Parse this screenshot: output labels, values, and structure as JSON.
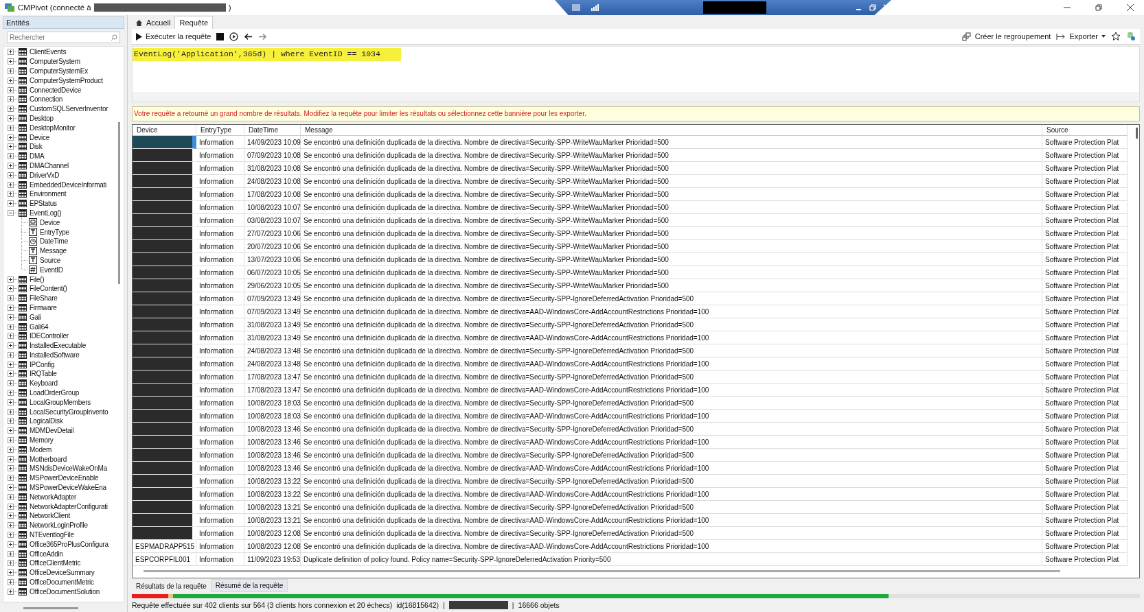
{
  "window": {
    "title_prefix": "CMPivot (connecté à",
    "title_suffix": ")"
  },
  "entities": {
    "header": "Entités",
    "search": {
      "placeholder": "Rechercher"
    },
    "items": [
      {
        "label": "ClientEvents",
        "expanded": false
      },
      {
        "label": "ComputerSystem",
        "expanded": false
      },
      {
        "label": "ComputerSystemEx",
        "expanded": false
      },
      {
        "label": "ComputerSystemProduct",
        "expanded": false
      },
      {
        "label": "ConnectedDevice",
        "expanded": false
      },
      {
        "label": "Connection",
        "expanded": false
      },
      {
        "label": "CustomSQLServerInventor",
        "expanded": false
      },
      {
        "label": "Desktop",
        "expanded": false
      },
      {
        "label": "DesktopMonitor",
        "expanded": false
      },
      {
        "label": "Device",
        "expanded": false
      },
      {
        "label": "Disk",
        "expanded": false
      },
      {
        "label": "DMA",
        "expanded": false
      },
      {
        "label": "DMAChannel",
        "expanded": false
      },
      {
        "label": "DriverVxD",
        "expanded": false
      },
      {
        "label": "EmbeddedDeviceInformati",
        "expanded": false
      },
      {
        "label": "Environment",
        "expanded": false
      },
      {
        "label": "EPStatus",
        "expanded": false
      },
      {
        "label": "EventLog()",
        "expanded": true,
        "children": [
          {
            "label": "Device",
            "kind": "device"
          },
          {
            "label": "EntryType",
            "kind": "text"
          },
          {
            "label": "DateTime",
            "kind": "clock"
          },
          {
            "label": "Message",
            "kind": "text"
          },
          {
            "label": "Source",
            "kind": "text"
          },
          {
            "label": "EventID",
            "kind": "number"
          }
        ]
      },
      {
        "label": "File()",
        "expanded": false
      },
      {
        "label": "FileContent()",
        "expanded": false
      },
      {
        "label": "FileShare",
        "expanded": false
      },
      {
        "label": "Firmware",
        "expanded": false
      },
      {
        "label": "Gali",
        "expanded": false
      },
      {
        "label": "Gali64",
        "expanded": false
      },
      {
        "label": "IDEController",
        "expanded": false
      },
      {
        "label": "InstalledExecutable",
        "expanded": false
      },
      {
        "label": "InstalledSoftware",
        "expanded": false
      },
      {
        "label": "IPConfig",
        "expanded": false
      },
      {
        "label": "IRQTable",
        "expanded": false
      },
      {
        "label": "Keyboard",
        "expanded": false
      },
      {
        "label": "LoadOrderGroup",
        "expanded": false
      },
      {
        "label": "LocalGroupMembers",
        "expanded": false
      },
      {
        "label": "LocalSecurityGroupInvento",
        "expanded": false
      },
      {
        "label": "LogicalDisk",
        "expanded": false
      },
      {
        "label": "MDMDevDetail",
        "expanded": false
      },
      {
        "label": "Memory",
        "expanded": false
      },
      {
        "label": "Modem",
        "expanded": false
      },
      {
        "label": "Motherboard",
        "expanded": false
      },
      {
        "label": "MSNdisDeviceWakeOnMa",
        "expanded": false
      },
      {
        "label": "MSPowerDeviceEnable",
        "expanded": false
      },
      {
        "label": "MSPowerDeviceWakeEna",
        "expanded": false
      },
      {
        "label": "NetworkAdapter",
        "expanded": false
      },
      {
        "label": "NetworkAdapterConfigurati",
        "expanded": false
      },
      {
        "label": "NetworkClient",
        "expanded": false
      },
      {
        "label": "NetworkLoginProfile",
        "expanded": false
      },
      {
        "label": "NTEventlogFile",
        "expanded": false
      },
      {
        "label": "Office365ProPlusConfigura",
        "expanded": false
      },
      {
        "label": "OfficeAddin",
        "expanded": false
      },
      {
        "label": "OfficeClientMetric",
        "expanded": false
      },
      {
        "label": "OfficeDeviceSummary",
        "expanded": false
      },
      {
        "label": "OfficeDocumentMetric",
        "expanded": false
      },
      {
        "label": "OfficeDocumentSolution",
        "expanded": false
      }
    ]
  },
  "tabs": [
    {
      "label": "Accueil",
      "selected": false,
      "kind": "home"
    },
    {
      "label": "Requête",
      "selected": true
    }
  ],
  "toolbar": {
    "run": "Exécuter la requête",
    "group": "Créer le regroupement",
    "export": "Exporter"
  },
  "query": "EventLog('Application',365d) | where EventID == 1034",
  "banner": "Votre requête a retourné un grand nombre de résultats. Modifiez la requête pour limiter les résultats ou sélectionnez cette bannière pour les exporter.",
  "table": {
    "columns": [
      "Device",
      "EntryType",
      "DateTime",
      "Message",
      "Source"
    ],
    "rows": [
      {
        "redacted": true,
        "selected": true,
        "type": "Information",
        "time": "14/09/2023 10:09",
        "message": "Se encontró una definición duplicada de la directiva. Nombre de directiva=Security-SPP-WriteWauMarker  Prioridad=500",
        "source": "Software Protection Plat"
      },
      {
        "redacted": true,
        "selected": false,
        "type": "Information",
        "time": "07/09/2023 10:08",
        "message": "Se encontró una definición duplicada de la directiva. Nombre de directiva=Security-SPP-WriteWauMarker  Prioridad=500",
        "source": "Software Protection Plat"
      },
      {
        "redacted": true,
        "selected": false,
        "type": "Information",
        "time": "31/08/2023 10:08",
        "message": "Se encontró una definición duplicada de la directiva. Nombre de directiva=Security-SPP-WriteWauMarker  Prioridad=500",
        "source": "Software Protection Plat"
      },
      {
        "redacted": true,
        "selected": false,
        "type": "Information",
        "time": "24/08/2023 10:08",
        "message": "Se encontró una definición duplicada de la directiva. Nombre de directiva=Security-SPP-WriteWauMarker  Prioridad=500",
        "source": "Software Protection Plat"
      },
      {
        "redacted": true,
        "selected": false,
        "type": "Information",
        "time": "17/08/2023 10:08",
        "message": "Se encontró una definición duplicada de la directiva. Nombre de directiva=Security-SPP-WriteWauMarker  Prioridad=500",
        "source": "Software Protection Plat"
      },
      {
        "redacted": true,
        "selected": false,
        "type": "Information",
        "time": "10/08/2023 10:07",
        "message": "Se encontró una definición duplicada de la directiva. Nombre de directiva=Security-SPP-WriteWauMarker  Prioridad=500",
        "source": "Software Protection Plat"
      },
      {
        "redacted": true,
        "selected": false,
        "type": "Information",
        "time": "03/08/2023 10:07",
        "message": "Se encontró una definición duplicada de la directiva. Nombre de directiva=Security-SPP-WriteWauMarker  Prioridad=500",
        "source": "Software Protection Plat"
      },
      {
        "redacted": true,
        "selected": false,
        "type": "Information",
        "time": "27/07/2023 10:06",
        "message": "Se encontró una definición duplicada de la directiva. Nombre de directiva=Security-SPP-WriteWauMarker  Prioridad=500",
        "source": "Software Protection Plat"
      },
      {
        "redacted": true,
        "selected": false,
        "type": "Information",
        "time": "20/07/2023 10:06",
        "message": "Se encontró una definición duplicada de la directiva. Nombre de directiva=Security-SPP-WriteWauMarker  Prioridad=500",
        "source": "Software Protection Plat"
      },
      {
        "redacted": true,
        "selected": false,
        "type": "Information",
        "time": "13/07/2023 10:06",
        "message": "Se encontró una definición duplicada de la directiva. Nombre de directiva=Security-SPP-WriteWauMarker  Prioridad=500",
        "source": "Software Protection Plat"
      },
      {
        "redacted": true,
        "selected": false,
        "type": "Information",
        "time": "06/07/2023 10:05",
        "message": "Se encontró una definición duplicada de la directiva. Nombre de directiva=Security-SPP-WriteWauMarker  Prioridad=500",
        "source": "Software Protection Plat"
      },
      {
        "redacted": true,
        "selected": false,
        "type": "Information",
        "time": "29/06/2023 10:05",
        "message": "Se encontró una definición duplicada de la directiva. Nombre de directiva=Security-SPP-WriteWauMarker  Prioridad=500",
        "source": "Software Protection Plat"
      },
      {
        "redacted": true,
        "selected": false,
        "type": "Information",
        "time": "07/09/2023 13:49",
        "message": "Se encontró una definición duplicada de la directiva. Nombre de directiva=Security-SPP-IgnoreDeferredActivation  Prioridad=500",
        "source": "Software Protection Plat"
      },
      {
        "redacted": true,
        "selected": false,
        "type": "Information",
        "time": "07/09/2023 13:49",
        "message": "Se encontró una definición duplicada de la directiva. Nombre de directiva=AAD-WindowsCore-AddAccountRestrictions  Prioridad=100",
        "source": "Software Protection Plat"
      },
      {
        "redacted": true,
        "selected": false,
        "type": "Information",
        "time": "31/08/2023 13:49",
        "message": "Se encontró una definición duplicada de la directiva. Nombre de directiva=Security-SPP-IgnoreDeferredActivation  Prioridad=500",
        "source": "Software Protection Plat"
      },
      {
        "redacted": true,
        "selected": false,
        "type": "Information",
        "time": "31/08/2023 13:49",
        "message": "Se encontró una definición duplicada de la directiva. Nombre de directiva=AAD-WindowsCore-AddAccountRestrictions  Prioridad=100",
        "source": "Software Protection Plat"
      },
      {
        "redacted": true,
        "selected": false,
        "type": "Information",
        "time": "24/08/2023 13:48",
        "message": "Se encontró una definición duplicada de la directiva. Nombre de directiva=Security-SPP-IgnoreDeferredActivation  Prioridad=500",
        "source": "Software Protection Plat"
      },
      {
        "redacted": true,
        "selected": false,
        "type": "Information",
        "time": "24/08/2023 13:48",
        "message": "Se encontró una definición duplicada de la directiva. Nombre de directiva=AAD-WindowsCore-AddAccountRestrictions  Prioridad=100",
        "source": "Software Protection Plat"
      },
      {
        "redacted": true,
        "selected": false,
        "type": "Information",
        "time": "17/08/2023 13:47",
        "message": "Se encontró una definición duplicada de la directiva. Nombre de directiva=Security-SPP-IgnoreDeferredActivation  Prioridad=500",
        "source": "Software Protection Plat"
      },
      {
        "redacted": true,
        "selected": false,
        "type": "Information",
        "time": "17/08/2023 13:47",
        "message": "Se encontró una definición duplicada de la directiva. Nombre de directiva=AAD-WindowsCore-AddAccountRestrictions  Prioridad=100",
        "source": "Software Protection Plat"
      },
      {
        "redacted": true,
        "selected": false,
        "type": "Information",
        "time": "10/08/2023 18:03",
        "message": "Se encontró una definición duplicada de la directiva. Nombre de directiva=Security-SPP-IgnoreDeferredActivation  Prioridad=500",
        "source": "Software Protection Plat"
      },
      {
        "redacted": true,
        "selected": false,
        "type": "Information",
        "time": "10/08/2023 18:03",
        "message": "Se encontró una definición duplicada de la directiva. Nombre de directiva=AAD-WindowsCore-AddAccountRestrictions  Prioridad=100",
        "source": "Software Protection Plat"
      },
      {
        "redacted": true,
        "selected": false,
        "type": "Information",
        "time": "10/08/2023 13:46",
        "message": "Se encontró una definición duplicada de la directiva. Nombre de directiva=Security-SPP-IgnoreDeferredActivation  Prioridad=500",
        "source": "Software Protection Plat"
      },
      {
        "redacted": true,
        "selected": false,
        "type": "Information",
        "time": "10/08/2023 13:46",
        "message": "Se encontró una definición duplicada de la directiva. Nombre de directiva=AAD-WindowsCore-AddAccountRestrictions  Prioridad=100",
        "source": "Software Protection Plat"
      },
      {
        "redacted": true,
        "selected": false,
        "type": "Information",
        "time": "10/08/2023 13:46",
        "message": "Se encontró una definición duplicada de la directiva. Nombre de directiva=Security-SPP-IgnoreDeferredActivation  Prioridad=500",
        "source": "Software Protection Plat"
      },
      {
        "redacted": true,
        "selected": false,
        "type": "Information",
        "time": "10/08/2023 13:46",
        "message": "Se encontró una definición duplicada de la directiva. Nombre de directiva=AAD-WindowsCore-AddAccountRestrictions  Prioridad=100",
        "source": "Software Protection Plat"
      },
      {
        "redacted": true,
        "selected": false,
        "type": "Information",
        "time": "10/08/2023 13:22",
        "message": "Se encontró una definición duplicada de la directiva. Nombre de directiva=Security-SPP-IgnoreDeferredActivation  Prioridad=500",
        "source": "Software Protection Plat"
      },
      {
        "redacted": true,
        "selected": false,
        "type": "Information",
        "time": "10/08/2023 13:22",
        "message": "Se encontró una definición duplicada de la directiva. Nombre de directiva=AAD-WindowsCore-AddAccountRestrictions  Prioridad=100",
        "source": "Software Protection Plat"
      },
      {
        "redacted": true,
        "selected": false,
        "type": "Information",
        "time": "10/08/2023 13:21",
        "message": "Se encontró una definición duplicada de la directiva. Nombre de directiva=Security-SPP-IgnoreDeferredActivation  Prioridad=500",
        "source": "Software Protection Plat"
      },
      {
        "redacted": true,
        "selected": false,
        "type": "Information",
        "time": "10/08/2023 13:21",
        "message": "Se encontró una definición duplicada de la directiva. Nombre de directiva=AAD-WindowsCore-AddAccountRestrictions  Prioridad=100",
        "source": "Software Protection Plat"
      },
      {
        "redacted": true,
        "selected": false,
        "type": "Information",
        "time": "10/08/2023 12:08",
        "message": "Se encontró una definición duplicada de la directiva. Nombre de directiva=Security-SPP-IgnoreDeferredActivation  Prioridad=500",
        "source": "Software Protection Plat"
      },
      {
        "redacted": false,
        "selected": false,
        "device": "ESPMADRAPP515",
        "type": "Information",
        "time": "10/08/2023 12:08",
        "message": "Se encontró una definición duplicada de la directiva. Nombre de directiva=AAD-WindowsCore-AddAccountRestrictions  Prioridad=100",
        "source": "Software Protection Plat"
      },
      {
        "redacted": false,
        "selected": false,
        "device": "ESPCORPFIL001",
        "type": "Information",
        "time": "11/09/2023 19:53",
        "message": "Duplicate definition of policy found. Policy name=Security-SPP-IgnoreDeferredActivation  Priority=500",
        "source": "Software Protection Plat"
      }
    ]
  },
  "result_tabs": [
    {
      "label": "Résultats de la requête",
      "selected": true
    },
    {
      "label": "Résumé de la requête",
      "selected": false
    }
  ],
  "progress": [
    {
      "level": 0.751,
      "color": "#1fa83a"
    },
    {
      "level": 0.036,
      "color": "#e81e1e"
    },
    {
      "level": 0.005,
      "color": "#e6c27a"
    }
  ],
  "status": {
    "summary": "Requête effectuée sur 402 clients sur 564 (3 clients hors connexion et 20 échecs)",
    "id": "id(16815642)",
    "separator": "|",
    "count": "16666 objets"
  }
}
